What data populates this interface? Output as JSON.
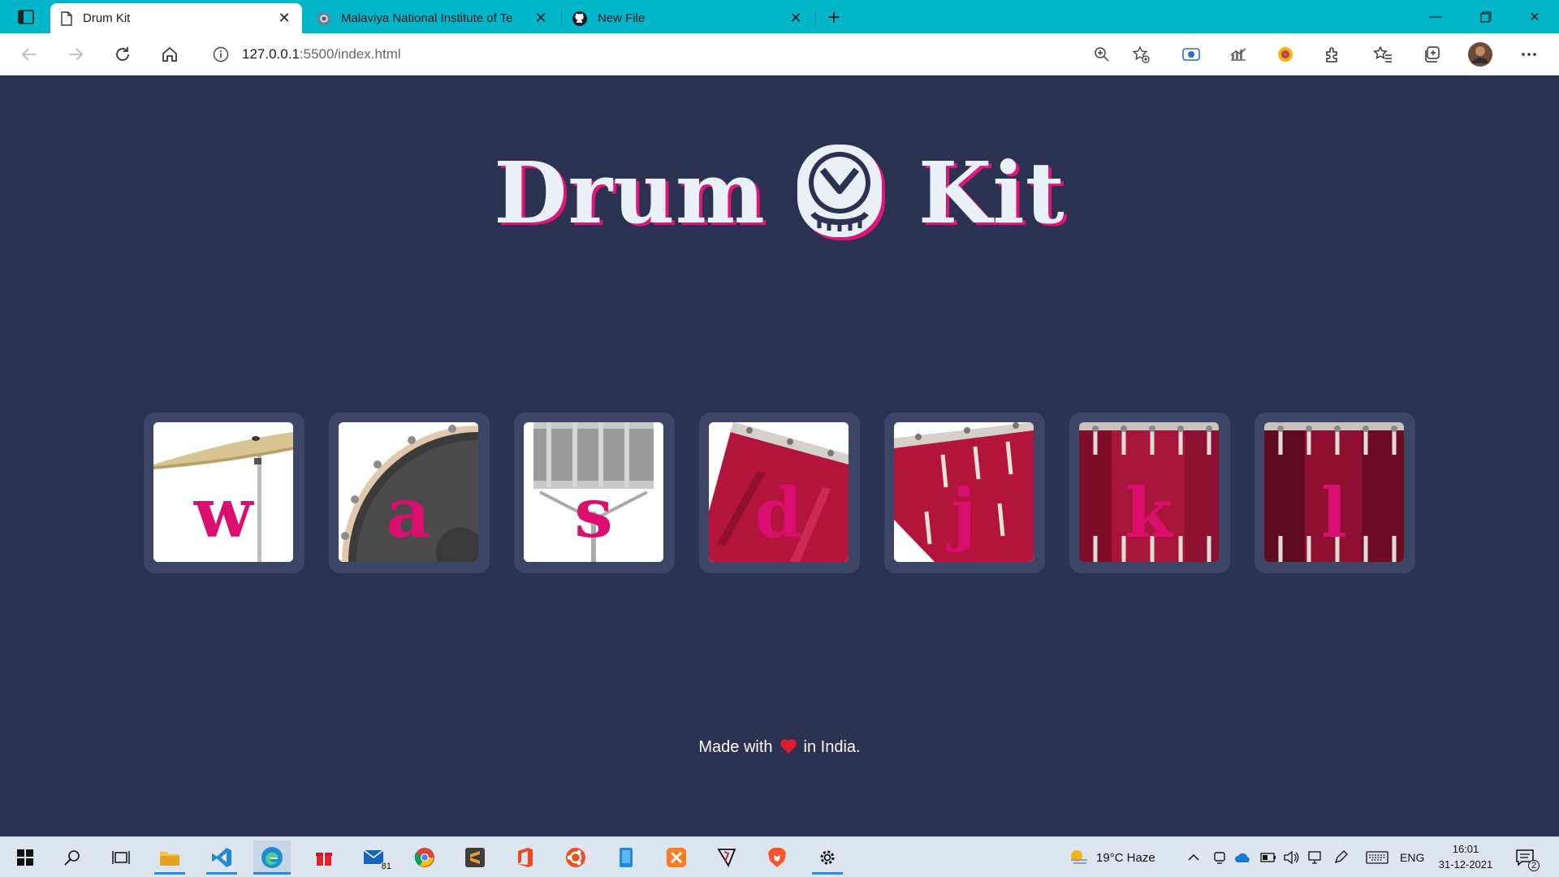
{
  "browser": {
    "tabs": [
      {
        "title": "Drum Kit",
        "active": true
      },
      {
        "title": "Malaviya National Institute of Te",
        "active": false
      },
      {
        "title": "New File",
        "active": false
      }
    ],
    "url_host": "127.0.0.1",
    "url_rest": ":5500/index.html",
    "accent_color": "#03b5c9"
  },
  "page": {
    "title_left": "Drum",
    "title_right": "Kit",
    "keys": [
      {
        "letter": "w",
        "instrument": "crash-cymbal"
      },
      {
        "letter": "a",
        "instrument": "kick-drum"
      },
      {
        "letter": "s",
        "instrument": "snare-drum"
      },
      {
        "letter": "d",
        "instrument": "tom-1"
      },
      {
        "letter": "j",
        "instrument": "tom-2"
      },
      {
        "letter": "k",
        "instrument": "tom-3"
      },
      {
        "letter": "l",
        "instrument": "tom-4"
      }
    ],
    "footer_before": "Made with",
    "footer_after": "in India.",
    "colors": {
      "background": "#2b3150",
      "accent": "#da0e6e",
      "title": "#e9f1f7"
    }
  },
  "taskbar": {
    "weather": "19°C  Haze",
    "language": "ENG",
    "time": "16:01",
    "date": "31-12-2021",
    "mail_badge": "81",
    "notification_count": "2"
  }
}
